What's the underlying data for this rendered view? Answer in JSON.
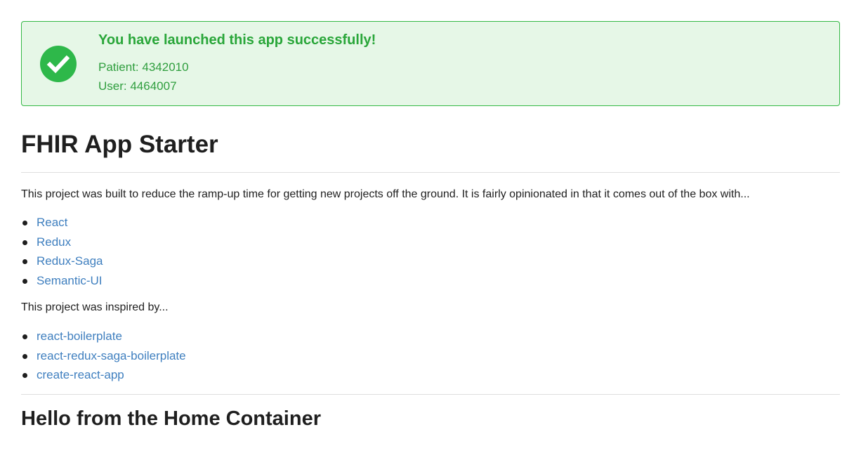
{
  "message": {
    "header": "You have launched this app successfully!",
    "patient": "Patient: 4342010",
    "user": "User: 4464007",
    "icon": "checkmark-circle-icon",
    "colors": {
      "background": "#e6f7e7",
      "border": "#33b845",
      "text": "#2aa13a"
    }
  },
  "page": {
    "title": "FHIR App Starter",
    "intro": "This project was built to reduce the ramp-up time for getting new projects off the ground. It is fairly opinionated in that it comes out of the box with...",
    "stack_links": [
      {
        "label": "React"
      },
      {
        "label": "Redux"
      },
      {
        "label": "Redux-Saga"
      },
      {
        "label": "Semantic-UI"
      }
    ],
    "inspired_text": "This project was inspired by...",
    "inspired_links": [
      {
        "label": "react-boilerplate"
      },
      {
        "label": "react-redux-saga-boilerplate"
      },
      {
        "label": "create-react-app"
      }
    ],
    "home_title": "Hello from the Home Container",
    "link_color": "#3f7fbf"
  }
}
